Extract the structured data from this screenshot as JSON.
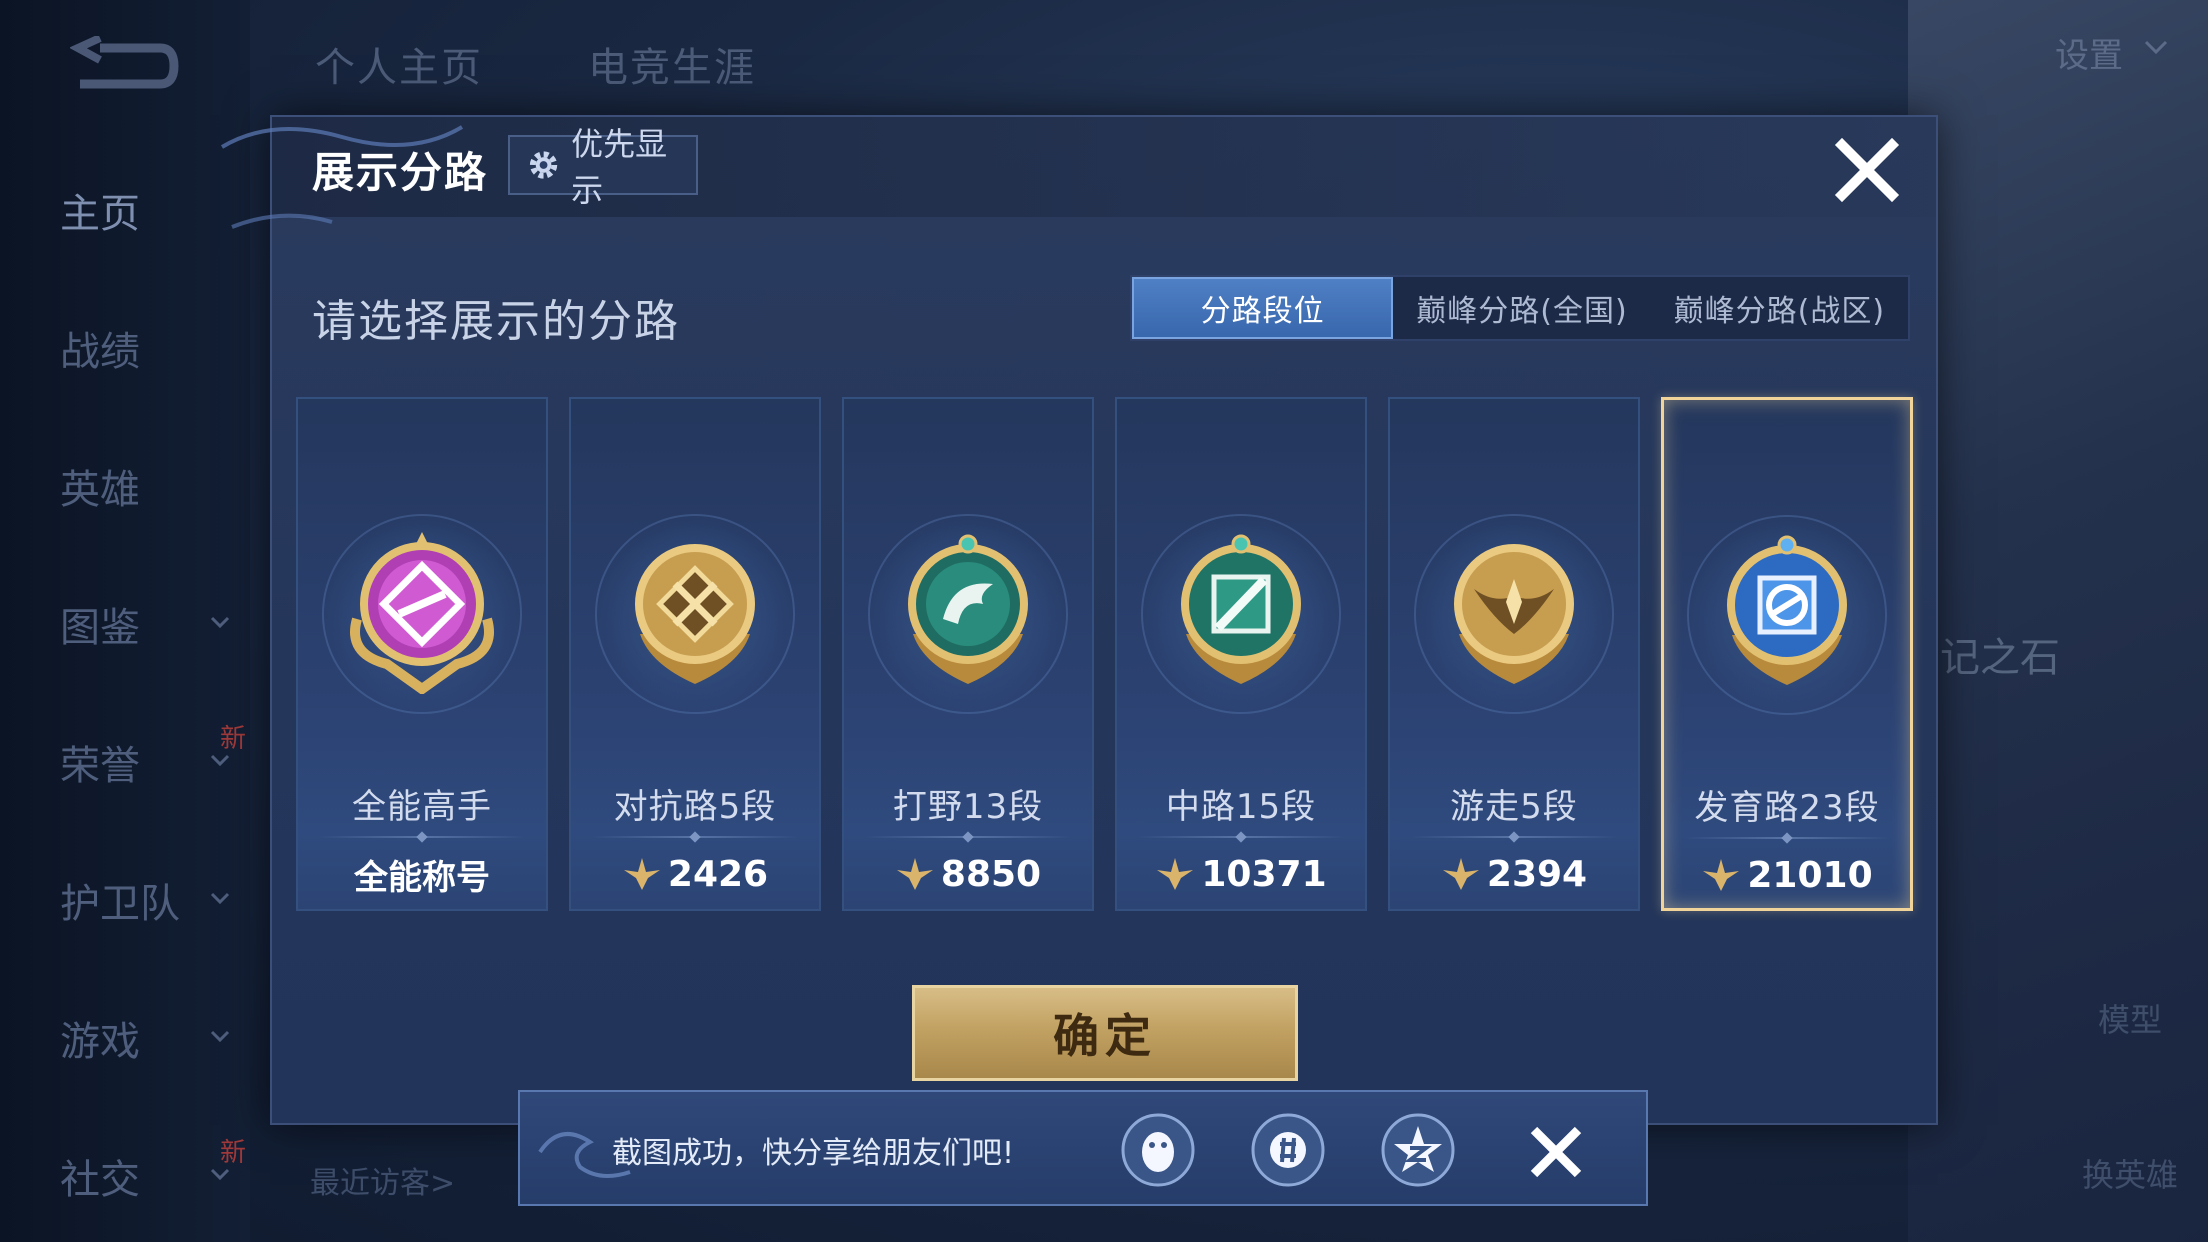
{
  "top_tabs": [
    "个人主页",
    "电竞生涯"
  ],
  "sidebar": {
    "items": [
      {
        "label": "主页",
        "active": true,
        "expandable": false,
        "new": false
      },
      {
        "label": "战绩",
        "active": false,
        "expandable": false,
        "new": false
      },
      {
        "label": "英雄",
        "active": false,
        "expandable": false,
        "new": false
      },
      {
        "label": "图鉴",
        "active": false,
        "expandable": true,
        "new": false
      },
      {
        "label": "荣誉",
        "active": false,
        "expandable": true,
        "new": true
      },
      {
        "label": "护卫队",
        "active": false,
        "expandable": true,
        "new": false
      },
      {
        "label": "游戏",
        "active": false,
        "expandable": true,
        "new": false
      },
      {
        "label": "社交",
        "active": false,
        "expandable": true,
        "new": true
      }
    ],
    "new_badge": "新"
  },
  "settings_label": "设置",
  "recent_visitors": "最近访客>",
  "right_side": {
    "stone_text": "记之石",
    "model_label": "模型",
    "change_hero_label": "换英雄"
  },
  "dialog": {
    "title": "展示分路",
    "priority_button": "优先显示",
    "subtitle": "请选择展示的分路",
    "tabs": [
      {
        "label": "分路段位",
        "active": true
      },
      {
        "label": "巅峰分路(全国)",
        "active": false
      },
      {
        "label": "巅峰分路(战区)",
        "active": false
      }
    ],
    "cards": [
      {
        "name": "全能高手",
        "value": "全能称号",
        "emblem": "all-round-emblem-icon",
        "is_title": true,
        "selected": false
      },
      {
        "name": "对抗路5段",
        "value": "2426",
        "emblem": "clash-lane-emblem-icon",
        "is_title": false,
        "selected": false
      },
      {
        "name": "打野13段",
        "value": "8850",
        "emblem": "jungle-emblem-icon",
        "is_title": false,
        "selected": false
      },
      {
        "name": "中路15段",
        "value": "10371",
        "emblem": "mid-lane-emblem-icon",
        "is_title": false,
        "selected": false
      },
      {
        "name": "游走5段",
        "value": "2394",
        "emblem": "roam-emblem-icon",
        "is_title": false,
        "selected": false
      },
      {
        "name": "发育路23段",
        "value": "21010",
        "emblem": "farm-lane-emblem-icon",
        "is_title": false,
        "selected": true
      }
    ],
    "confirm_button": "确定"
  },
  "share_bar": {
    "text": "截图成功，快分享给朋友们吧!",
    "icons": [
      "qq-icon",
      "wechat-moments-icon",
      "qzone-icon"
    ]
  },
  "colors": {
    "gold": "#f0d49a",
    "active_tab": "#3867ad",
    "confirm": "#c2a263"
  }
}
